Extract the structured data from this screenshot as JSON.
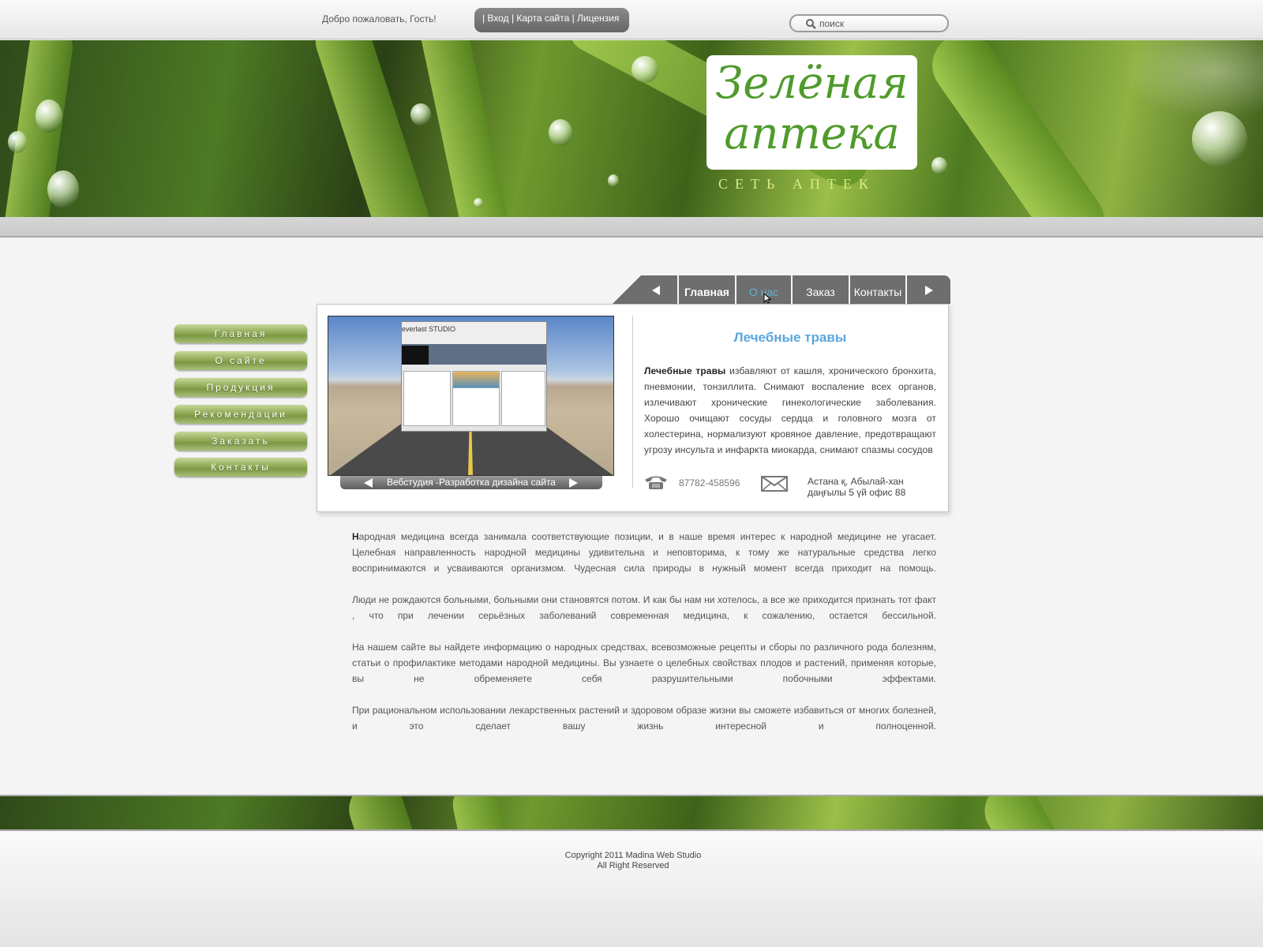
{
  "topbar": {
    "welcome": "Добро пожаловать, Гость!",
    "links": [
      "| Вход",
      " | Карта сайта",
      " | Лицензия"
    ],
    "search_value": "поиск"
  },
  "header": {
    "logo_line1": "Зелёная",
    "logo_line2": "аптека",
    "logo_sub": "СЕТЬ АПТЕК"
  },
  "tabs": {
    "items": [
      "Главная",
      "О нас",
      "Заказ",
      "Контакты"
    ],
    "active": "Главная"
  },
  "sidebar": {
    "items": [
      "Главная",
      "О сайте",
      "Продукция",
      "Рекомендации",
      "Заказать",
      "Контакты"
    ]
  },
  "slider": {
    "caption": "Вебстудия -Разработка дизайна сайта",
    "mini_title": "everlast STUDIO"
  },
  "box": {
    "title": "Лечебные травы",
    "text_bold": "Лечебные травы",
    "text": " избавляют от кашля, хронического бронхита, пневмонии, тонзиллита. Снимают воспаление всех органов, излечивают хронические гинекологические заболевания. Хорошо очищают сосуды сердца и головного мозга от холестерина, нормализуют кровяное давление, предотвращают угрозу инсульта и инфаркта миокарда, снимают спазмы сосудов",
    "phone": "87782-458596",
    "address_line1": "Астана қ, Абылай-хан",
    "address_line2": "даңғылы 5 үй офис 88"
  },
  "main": {
    "paragraphs": [
      "Народная медицина всегда занимала соответствующие позиции, и в наше время интерес к народной медицине не угасает. Целебная направленность народной медицины удивительна и неповторима, к тому же натуральные средства легко воспринимаются и усваиваются организмом. Чудесная сила природы в нужный момент всегда приходит на помощь.",
      "Люди не рождаются больными, больными они становятся потом. И как бы нам ни хотелось, а все же приходится признать тот факт , что при лечении серьёзных заболеваний современная медицина, к сожалению, остается бессильной.",
      "На нашем сайте вы найдете информацию о народных средствах, всевозможные рецепты и сборы по различного рода болезням, статьи о профилактике методами народной медицины. Вы узнаете о целебных свойствах плодов и растений, применяя которые, вы не обременяете себя разрушительными побочными эффектами.",
      "При рациональном использовании лекарственных растений и здоровом образе жизни вы сможете избавиться от многих болезней, и это сделает вашу жизнь интересной и полноценной."
    ]
  },
  "footer": {
    "copyright": "Copyright 2011 Madina Web Studio",
    "rights": "All Right Reserved"
  },
  "colors": {
    "accent_green": "#4f9b2c",
    "title_blue": "#5ba6dc",
    "tab_gray": "#6e6e6e",
    "hover_blue": "#5fb3d8"
  },
  "icons": [
    "search-icon",
    "phone-icon",
    "mail-icon",
    "arrow-left-icon",
    "arrow-right-icon",
    "cursor-icon"
  ]
}
